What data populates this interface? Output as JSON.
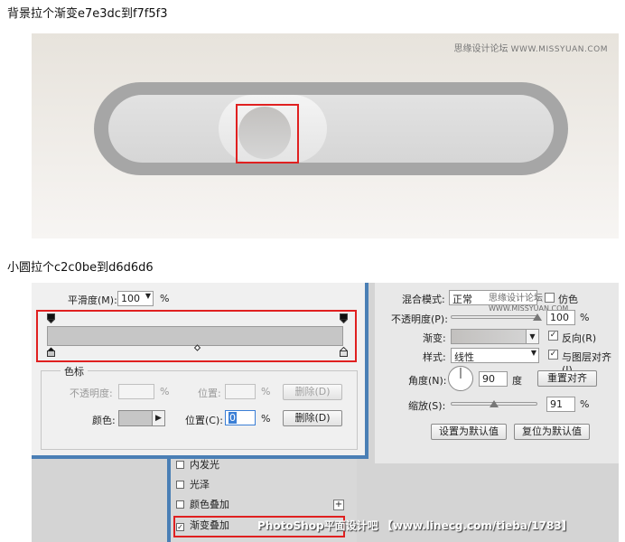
{
  "captions": {
    "top": "背景拉个渐变e7e3dc到f7f5f3",
    "middle": "小圆拉个c2c0be到d6d6d6"
  },
  "watermark": {
    "cn": "思缘设计论坛",
    "en": "WWW.MISSYUAN.COM"
  },
  "colors": {
    "bg_from": "#e7e3dc",
    "bg_to": "#f7f5f3",
    "circle_from": "#c2c0be",
    "circle_to": "#d6d6d6",
    "highlight": "#e02020"
  },
  "gradient_editor": {
    "smoothness_label": "平滑度(M):",
    "smoothness_value": "100",
    "smoothness_unit": "%",
    "stops_group_title": "色标",
    "opacity_label": "不透明度:",
    "opacity_unit": "%",
    "position_label_top": "位置:",
    "position_unit_top": "%",
    "delete_label_top": "删除(D)",
    "color_label": "颜色:",
    "position_label": "位置(C):",
    "position_value": "0",
    "position_unit": "%",
    "delete_label": "删除(D)"
  },
  "overlay_panel": {
    "blend_label": "混合模式:",
    "blend_value": "正常",
    "dither_label": "仿色",
    "opacity_label": "不透明度(P):",
    "opacity_value": "100",
    "opacity_unit": "%",
    "gradient_label": "渐变:",
    "reverse_label": "反向(R)",
    "style_label": "样式:",
    "style_value": "线性",
    "align_label": "与图层对齐(I)",
    "angle_label": "角度(N):",
    "angle_value": "90",
    "angle_unit": "度",
    "reset_align_label": "重置对齐",
    "scale_label": "缩放(S):",
    "scale_value": "91",
    "scale_unit": "%",
    "set_default_label": "设置为默认值",
    "reset_default_label": "复位为默认值"
  },
  "layer_styles": [
    {
      "label": "内发光",
      "checked": false
    },
    {
      "label": "光泽",
      "checked": false
    },
    {
      "label": "颜色叠加",
      "checked": false
    },
    {
      "label": "渐变叠加",
      "checked": true
    }
  ],
  "footer_watermark": "PhotoShop平面设计吧 【www.linecg.com/tieba/1783】"
}
